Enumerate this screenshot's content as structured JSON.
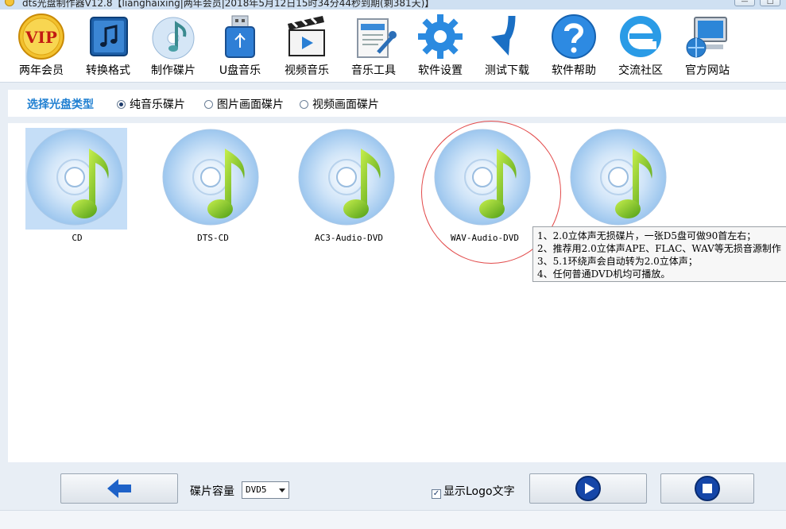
{
  "window": {
    "title": "dts光盘制作器V12.8【lianghaixing|两年会员|2018年5月12日15时34分44秒到期(剩381天)】",
    "minimize_glyph": "—",
    "maximize_glyph": "□"
  },
  "toolbar": {
    "items": [
      {
        "label": "两年会员",
        "icon": "vip-badge-icon",
        "vip_text": "VIP"
      },
      {
        "label": "转换格式",
        "icon": "music-note-square-icon"
      },
      {
        "label": "制作碟片",
        "icon": "disc-music-icon"
      },
      {
        "label": "U盘音乐",
        "icon": "usb-drive-icon"
      },
      {
        "label": "视频音乐",
        "icon": "clapperboard-play-icon"
      },
      {
        "label": "音乐工具",
        "icon": "tools-document-icon"
      },
      {
        "label": "软件设置",
        "icon": "gear-icon"
      },
      {
        "label": "测试下载",
        "icon": "download-arrow-icon"
      },
      {
        "label": "软件帮助",
        "icon": "help-question-icon"
      },
      {
        "label": "交流社区",
        "icon": "ie-browser-icon"
      },
      {
        "label": "官方网站",
        "icon": "computer-globe-icon"
      }
    ]
  },
  "disc_type": {
    "title": "选择光盘类型",
    "options": [
      {
        "label": "纯音乐碟片",
        "selected": true
      },
      {
        "label": "图片画面碟片",
        "selected": false
      },
      {
        "label": "视频画面碟片",
        "selected": false
      }
    ]
  },
  "formats": [
    {
      "label": "CD",
      "selected": true
    },
    {
      "label": "DTS-CD",
      "selected": false
    },
    {
      "label": "AC3-Audio-DVD",
      "selected": false
    },
    {
      "label": "WAV-Audio-DVD",
      "selected": false,
      "highlighted": true
    },
    {
      "label": "",
      "selected": false
    }
  ],
  "tooltip": {
    "lines": [
      "1、2.0立体声无损碟片，一张D5盘可做90首左右；",
      "2、推荐用2.0立体声APE、FLAC、WAV等无损音源制作",
      "3、5.1环绕声会自动转为2.0立体声；",
      "4、任何普通DVD机均可播放。"
    ]
  },
  "bottom": {
    "back_button": "back-arrow-icon",
    "capacity_label": "碟片容量",
    "capacity_value": "DVD5",
    "logo_checkbox_label": "显示Logo文字",
    "logo_checked": true,
    "play_button": "play-icon",
    "stop_button": "stop-icon"
  },
  "colors": {
    "accent": "#1f7fd1",
    "window_bg": "#e8eef5",
    "selection": "#c5def7",
    "highlight_circle": "#e24a4a"
  }
}
